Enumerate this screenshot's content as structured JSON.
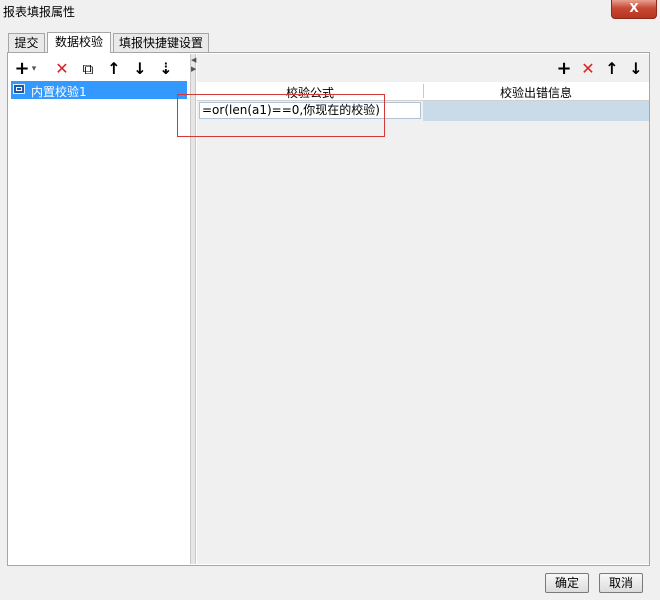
{
  "window": {
    "title": "报表填报属性",
    "close_label": "X"
  },
  "tabs": [
    {
      "label": "提交"
    },
    {
      "label": "数据校验"
    },
    {
      "label": "填报快捷键设置"
    }
  ],
  "left_toolbar": {
    "add": "+",
    "add_dropdown": "▾",
    "delete": "✕",
    "copy": "⧉",
    "up": "↑",
    "down": "↓",
    "sort": "⇣"
  },
  "tree": {
    "items": [
      {
        "label": "内置校验1"
      }
    ]
  },
  "right_toolbar": {
    "add": "+",
    "delete": "✕",
    "up": "↑",
    "down": "↓"
  },
  "grid": {
    "columns": [
      "校验公式",
      "校验出错信息"
    ],
    "rows": [
      {
        "formula": "=or(len(a1)==0,你现在的校验)",
        "message": ""
      }
    ]
  },
  "footer": {
    "ok_label": "确定",
    "cancel_label": "取消"
  },
  "colors": {
    "delete_red": "#e02020",
    "selection_blue": "#3399ff",
    "highlight_border": "#d4393a"
  }
}
